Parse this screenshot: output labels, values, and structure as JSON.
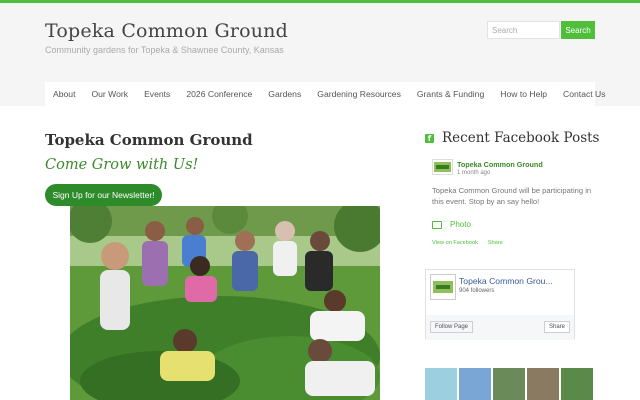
{
  "header": {
    "title": "Topeka Common Ground",
    "tagline": "Community gardens for Topeka & Shawnee County, Kansas",
    "search_placeholder": "Search",
    "search_button": "Search"
  },
  "nav": {
    "items": [
      "About",
      "Our Work",
      "Events",
      "2026 Conference",
      "Gardens",
      "Gardening Resources",
      "Grants & Funding",
      "How to Help",
      "Contact Us"
    ]
  },
  "main": {
    "title": "Topeka Common Ground",
    "slogan": "Come Grow with Us!",
    "newsletter_button": "Sign Up for our Newsletter!"
  },
  "sidebar": {
    "title": "Recent Facebook Posts",
    "post": {
      "author": "Topeka Common Ground",
      "time": "1 month ago",
      "text": "Topeka Common Ground will be participating in this event. Stop by an say hello!",
      "attachment_label": "Photo",
      "view_link": "View on Facebook",
      "share_link": "Share"
    },
    "page_card": {
      "name": "Topeka Common Grou...",
      "followers": "904 followers",
      "follow_button": "Follow Page",
      "share_button": "Share"
    }
  },
  "colors": {
    "accent": "#4fbf3a",
    "button_dark": "#2e8b2a",
    "facebook_blue": "#3b5998"
  }
}
